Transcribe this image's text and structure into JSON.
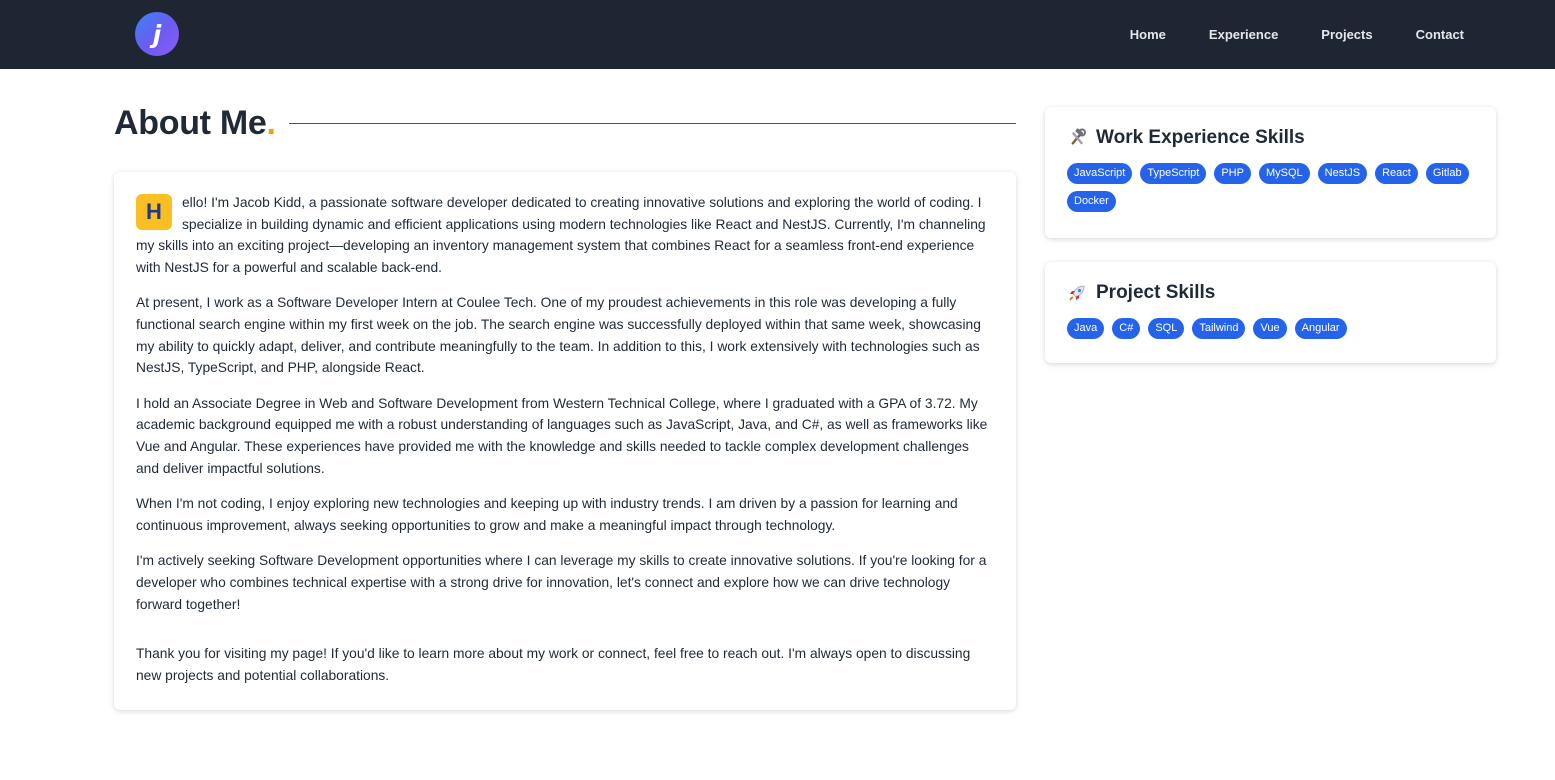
{
  "navbar": {
    "logo_letter": "j",
    "links": [
      {
        "label": "Home"
      },
      {
        "label": "Experience"
      },
      {
        "label": "Projects"
      },
      {
        "label": "Contact"
      }
    ]
  },
  "about": {
    "title": "About Me",
    "title_dot": ".",
    "dropcap": "H",
    "paragraphs": [
      "ello! I'm Jacob Kidd, a passionate software developer dedicated to creating innovative solutions and exploring the world of coding. I specialize in building dynamic and efficient applications using modern technologies like React and NestJS. Currently, I'm channeling my skills into an exciting project—developing an inventory management system that combines React for a seamless front-end experience with NestJS for a powerful and scalable back-end.",
      "At present, I work as a Software Developer Intern at Coulee Tech. One of my proudest achievements in this role was developing a fully functional search engine within my first week on the job. The search engine was successfully deployed within that same week, showcasing my ability to quickly adapt, deliver, and contribute meaningfully to the team. In addition to this, I work extensively with technologies such as NestJS, TypeScript, and PHP, alongside React.",
      "I hold an Associate Degree in Web and Software Development from Western Technical College, where I graduated with a GPA of 3.72. My academic background equipped me with a robust understanding of languages such as JavaScript, Java, and C#, as well as frameworks like Vue and Angular. These experiences have provided me with the knowledge and skills needed to tackle complex development challenges and deliver impactful solutions.",
      "When I'm not coding, I enjoy exploring new technologies and keeping up with industry trends. I am driven by a passion for learning and continuous improvement, always seeking opportunities to grow and make a meaningful impact through technology.",
      "I'm actively seeking Software Development opportunities where I can leverage my skills to create innovative solutions. If you're looking for a developer who combines technical expertise with a strong drive for innovation, let's connect and explore how we can drive technology forward together!",
      "Thank you for visiting my page! If you'd like to learn more about my work or connect, feel free to reach out. I'm always open to discussing new projects and potential collaborations."
    ]
  },
  "work_skills": {
    "icon": "wrench-hammer-icon",
    "title": "Work Experience Skills",
    "badges": [
      "JavaScript",
      "TypeScript",
      "PHP",
      "MySQL",
      "NestJS",
      "React",
      "Gitlab",
      "Docker"
    ]
  },
  "project_skills": {
    "icon": "rocket-icon",
    "title": "Project Skills",
    "badges": [
      "Java",
      "C#",
      "SQL",
      "Tailwind",
      "Vue",
      "Angular"
    ]
  },
  "colors": {
    "navbar_bg": "#1e2533",
    "accent_yellow": "#f59e0b",
    "dropcap_bg": "#fbbf24",
    "badge_blue": "#2563eb"
  }
}
